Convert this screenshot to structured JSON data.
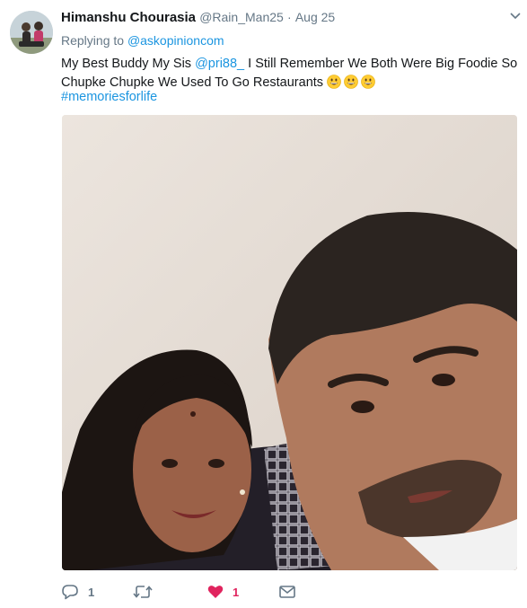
{
  "tweet": {
    "author_name": "Himanshu Chourasia",
    "handle": "@Rain_Man25",
    "separator": "·",
    "time": "Aug 25",
    "replying_prefix": "Replying to ",
    "replying_to": "@askopinioncom",
    "text_part1": "My Best Buddy My Sis ",
    "mention": "@pri88_",
    "text_part2": " I Still Remember We Both Were Big Foodie So Chupke Chupke We Used To Go Restaurants ",
    "hashtag": "#memoriesforlife",
    "emoji_names": [
      "grinning-face-emoji",
      "grinning-face-emoji",
      "grinning-face-emoji"
    ]
  },
  "actions": {
    "reply_count": "1",
    "retweet_count": "",
    "like_count": "1",
    "reply_icon": "reply-icon",
    "retweet_icon": "retweet-icon",
    "like_icon": "heart-icon",
    "dm_icon": "envelope-icon"
  },
  "colors": {
    "link": "#1b95e0",
    "muted": "#657786",
    "like": "#e0245e"
  }
}
